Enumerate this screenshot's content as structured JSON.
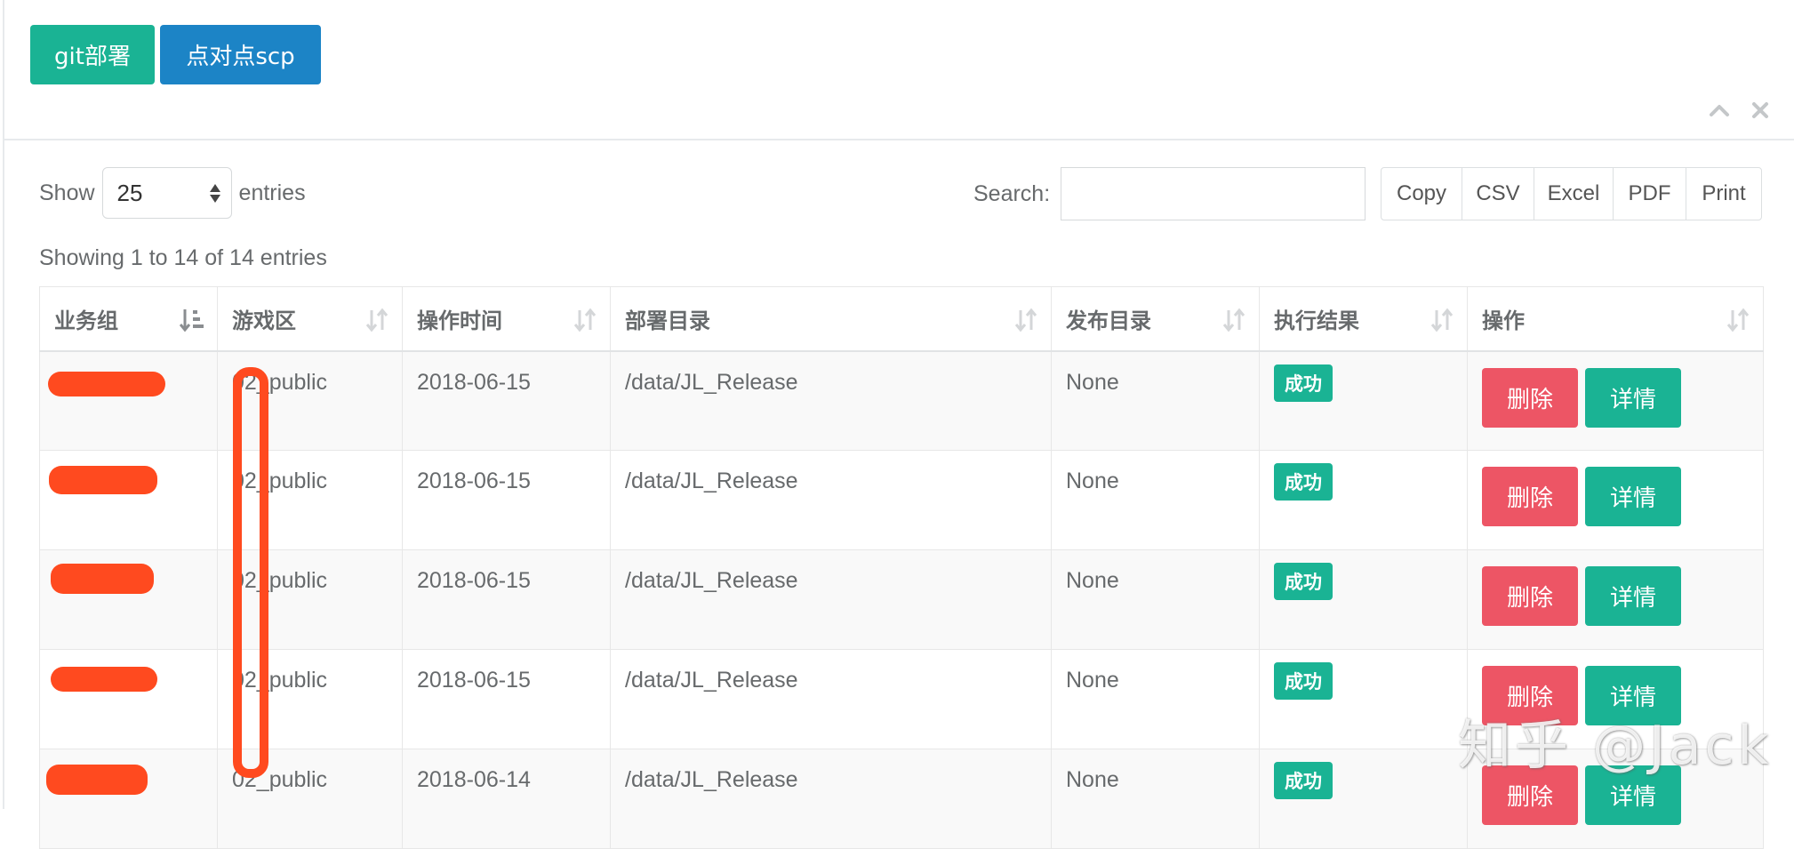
{
  "toolbar": {
    "git_label": "git部署",
    "scp_label": "点对点scp"
  },
  "panel_tools": {
    "collapse_icon": "chevron-up-icon",
    "close_icon": "close-icon"
  },
  "length": {
    "show_label": "Show",
    "value": "25",
    "entries_label": "entries"
  },
  "search": {
    "label": "Search:",
    "value": ""
  },
  "export": [
    "Copy",
    "CSV",
    "Excel",
    "PDF",
    "Print"
  ],
  "info": "Showing 1 to 14 of 14 entries",
  "table": {
    "columns": [
      "业务组",
      "游戏区",
      "操作时间",
      "部署目录",
      "发布目录",
      "执行结果",
      "操作"
    ],
    "sort_icons": [
      "sort-asc-icon",
      "sort-icon",
      "sort-icon",
      "sort-icon",
      "sort-icon",
      "sort-icon",
      "sort-icon"
    ],
    "rows": [
      {
        "group": "",
        "zone": "02_public",
        "time": "2018-06-15",
        "deploy_dir": "/data/JL_Release",
        "publish_dir": "None",
        "result": "成功",
        "delete": "删除",
        "detail": "详情"
      },
      {
        "group": "",
        "zone": "02_public",
        "time": "2018-06-15",
        "deploy_dir": "/data/JL_Release",
        "publish_dir": "None",
        "result": "成功",
        "delete": "删除",
        "detail": "详情"
      },
      {
        "group": "",
        "zone": "02_public",
        "time": "2018-06-15",
        "deploy_dir": "/data/JL_Release",
        "publish_dir": "None",
        "result": "成功",
        "delete": "删除",
        "detail": "详情"
      },
      {
        "group": "",
        "zone": "02_public",
        "time": "2018-06-15",
        "deploy_dir": "/data/JL_Release",
        "publish_dir": "None",
        "result": "成功",
        "delete": "删除",
        "detail": "详情"
      },
      {
        "group": "",
        "zone": "02_public",
        "time": "2018-06-14",
        "deploy_dir": "/data/JL_Release",
        "publish_dir": "None",
        "result": "成功",
        "delete": "删除",
        "detail": "详情"
      }
    ]
  },
  "colors": {
    "primary": "#1ab394",
    "info": "#1c84c6",
    "danger": "#ed5565",
    "redaction": "#ff4a1f"
  },
  "watermark": "知乎 @Jack"
}
